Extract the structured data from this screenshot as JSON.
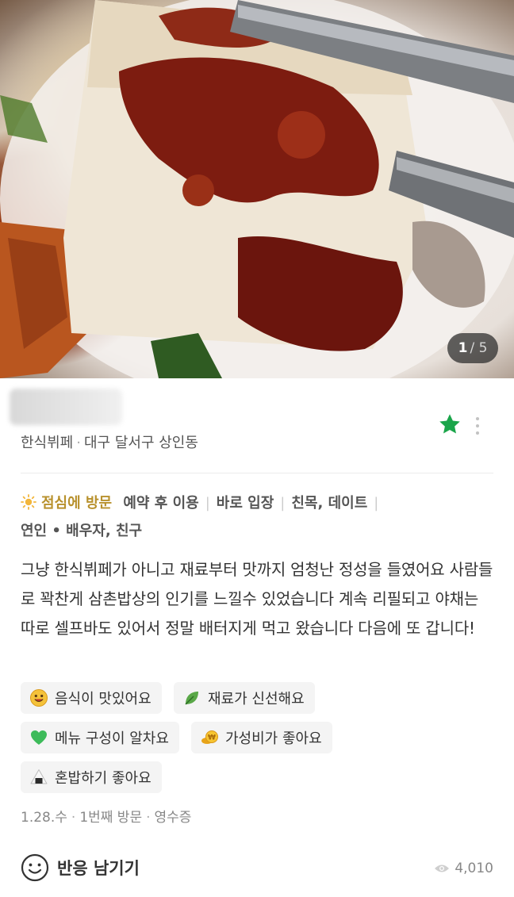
{
  "photo": {
    "description_icon": "food-photo",
    "counter_current": "1",
    "counter_total": "/ 5"
  },
  "place": {
    "category": "한식뷔페",
    "location": "대구 달서구 상인동"
  },
  "visit_tags": {
    "time": "점심에 방문",
    "reservation": "예약 후 이용",
    "entry": "바로 입장",
    "purpose": "친목, 데이트",
    "companions": "연인 • 배우자, 친구"
  },
  "review_text": "그냥 한식뷔페가 아니고 재료부터 맛까지 엄청난 정성을 들였어요 사람들로 꽉찬게 삼촌밥상의 인기를 느낄수 있었습니다 계속 리필되고 야채는 따로 셀프바도 있어서 정말 배터지게 먹고 왔습니다 다음에 또 갑니다!",
  "keywords": [
    {
      "icon": "smiley-icon",
      "label": "음식이 맛있어요"
    },
    {
      "icon": "leaf-icon",
      "label": "재료가 신선해요"
    },
    {
      "icon": "green-heart-icon",
      "label": "메뉴 구성이 알차요"
    },
    {
      "icon": "coin-icon",
      "label": "가성비가 좋아요"
    },
    {
      "icon": "rice-ball-icon",
      "label": "혼밥하기 좋아요"
    }
  ],
  "footer": {
    "date": "1.28.수",
    "visit_count": "1번째 방문",
    "verification": "영수증",
    "react_label": "반응 남기기",
    "views": "4,010"
  },
  "colors": {
    "accent_green": "#1aa54a",
    "visit_time_gold": "#b8912d"
  }
}
